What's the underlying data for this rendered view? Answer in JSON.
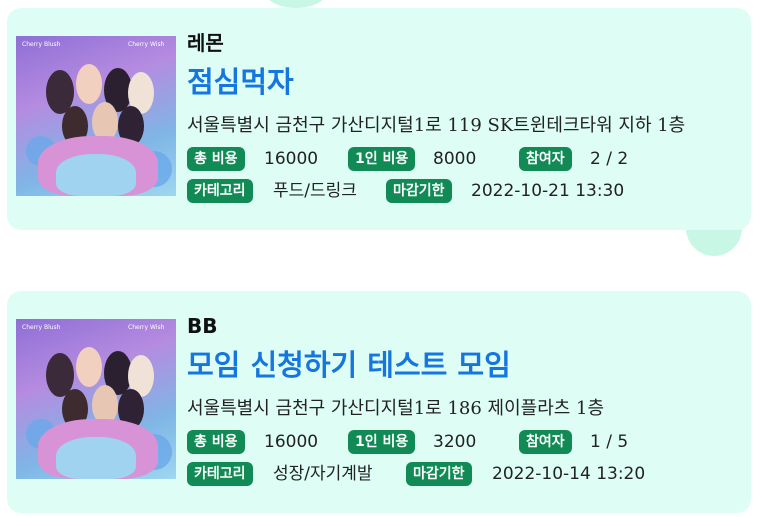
{
  "labels": {
    "total_cost": "총 비용",
    "per_person": "1인 비용",
    "participants": "참여자",
    "category": "카테고리",
    "deadline": "마감기한"
  },
  "thumbnail": {
    "brand_left": "Cherry Blush",
    "brand_right": "Cherry Wish"
  },
  "cards": [
    {
      "user": "레몬",
      "title": "점심먹자",
      "address": "서울특별시 금천구 가산디지털1로 119 SK트윈테크타워 지하 1층",
      "total_cost": "16000",
      "per_person": "8000",
      "participants": "2 / 2",
      "category": "푸드/드링크",
      "deadline": "2022-10-21 13:30"
    },
    {
      "user": "BB",
      "title": "모임 신청하기 테스트 모임",
      "address": "서울특별시 금천구 가산디지털1로 186 제이플라츠 1층",
      "total_cost": "16000",
      "per_person": "3200",
      "participants": "1 / 5",
      "category": "성장/자기계발",
      "deadline": "2022-10-14 13:20"
    }
  ]
}
